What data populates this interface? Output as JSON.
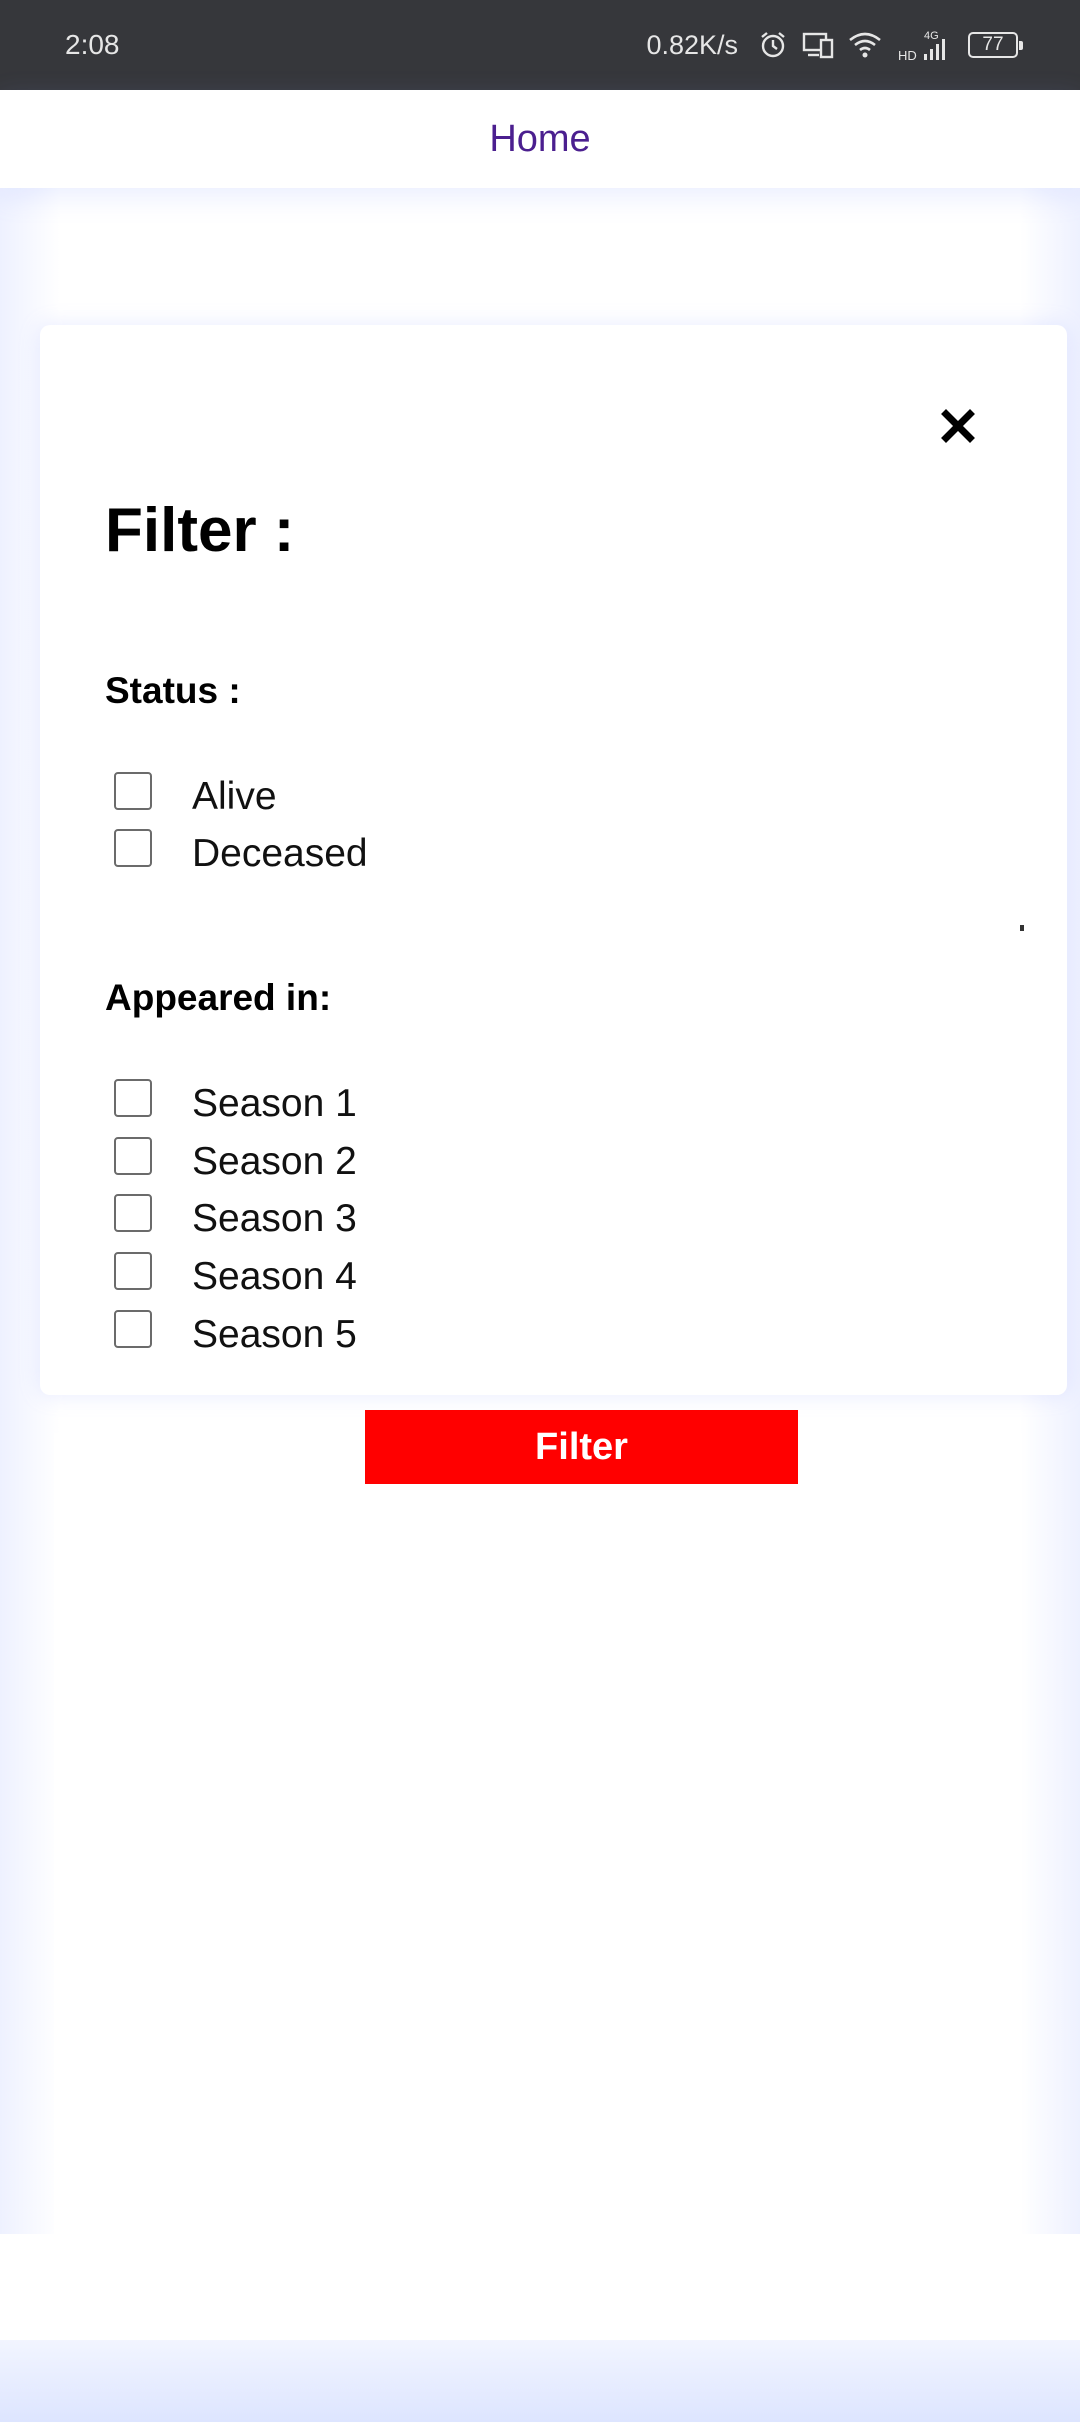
{
  "status_bar": {
    "time": "2:08",
    "network_speed": "0.82K/s",
    "battery_level": "77",
    "icons": [
      "alarm-icon",
      "cast-icon",
      "wifi-icon",
      "hd-icon",
      "signal-4g-icon",
      "battery-icon"
    ],
    "hd_text": "HD",
    "network_type": "4G"
  },
  "app_bar": {
    "title": "Home",
    "title_color": "#4b1f8f"
  },
  "modal": {
    "title": "Filter :",
    "close_icon": "close-icon",
    "status_section": {
      "label": "Status :",
      "options": [
        {
          "label": "Alive",
          "checked": false
        },
        {
          "label": "Deceased",
          "checked": false
        }
      ]
    },
    "appeared_section": {
      "label": "Appeared in:",
      "options": [
        {
          "label": "Season 1",
          "checked": false
        },
        {
          "label": "Season 2",
          "checked": false
        },
        {
          "label": "Season 3",
          "checked": false
        },
        {
          "label": "Season 4",
          "checked": false
        },
        {
          "label": "Season 5",
          "checked": false
        }
      ]
    }
  },
  "filter_button": {
    "label": "Filter",
    "color": "#ff0000"
  }
}
